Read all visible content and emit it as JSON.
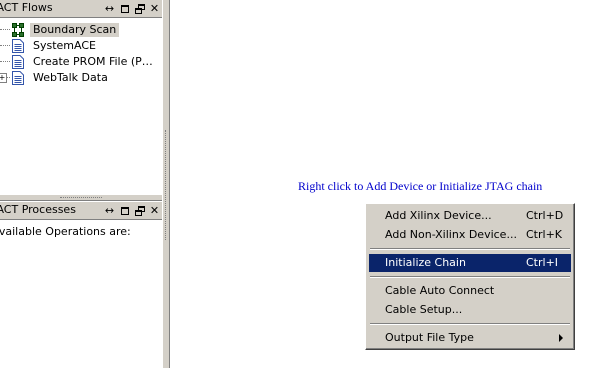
{
  "flows_panel": {
    "title": "iMPACT Flows",
    "items": [
      {
        "label": "Boundary Scan",
        "icon": "boundary-scan-icon"
      },
      {
        "label": "SystemACE",
        "icon": "document-icon"
      },
      {
        "label": "Create PROM File (P…",
        "icon": "document-icon"
      },
      {
        "label": "WebTalk Data",
        "icon": "document-icon"
      }
    ]
  },
  "processes_panel": {
    "title": "iMPACT Processes",
    "text": "Available Operations are:"
  },
  "workspace": {
    "hint": "Right click to Add Device or Initialize JTAG chain"
  },
  "context_menu": {
    "items": [
      {
        "label": "Add Xilinx Device...",
        "shortcut": "Ctrl+D"
      },
      {
        "label": "Add Non-Xilinx Device...",
        "shortcut": "Ctrl+K"
      },
      {
        "label": "Initialize Chain",
        "shortcut": "Ctrl+I"
      },
      {
        "label": "Cable Auto Connect",
        "shortcut": ""
      },
      {
        "label": "Cable Setup...",
        "shortcut": ""
      },
      {
        "label": "Output File Type",
        "shortcut": ""
      }
    ]
  },
  "colors": {
    "highlight": "#0a246a",
    "hint_text": "#0000cc",
    "chrome": "#d4d0c8"
  }
}
